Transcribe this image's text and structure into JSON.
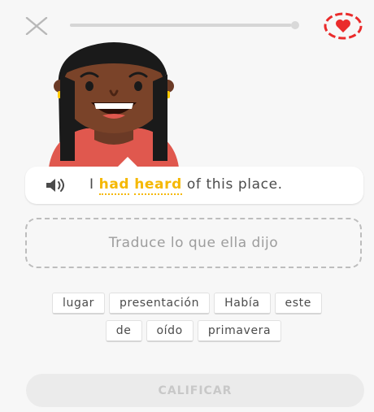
{
  "header": {
    "close_icon": "close-icon",
    "heart_icon": "heart-icon",
    "progress_fraction": 0.97
  },
  "prompt": {
    "speaker_icon": "speaker-icon",
    "sentence_parts": {
      "prefix": "I",
      "hint1": "had",
      "hint2": "heard",
      "suffix": "of this place."
    }
  },
  "answer": {
    "placeholder": "Traduce lo que ella dijo"
  },
  "word_bank": {
    "row1": [
      "lugar",
      "presentación",
      "Había",
      "este"
    ],
    "row2": [
      "de",
      "oído",
      "primavera"
    ]
  },
  "check_button": {
    "label": "CALIFICAR"
  },
  "colors": {
    "hint_yellow": "#f5b800",
    "heart_red": "#ea2b2b",
    "text_gray": "#4b4b4b"
  }
}
